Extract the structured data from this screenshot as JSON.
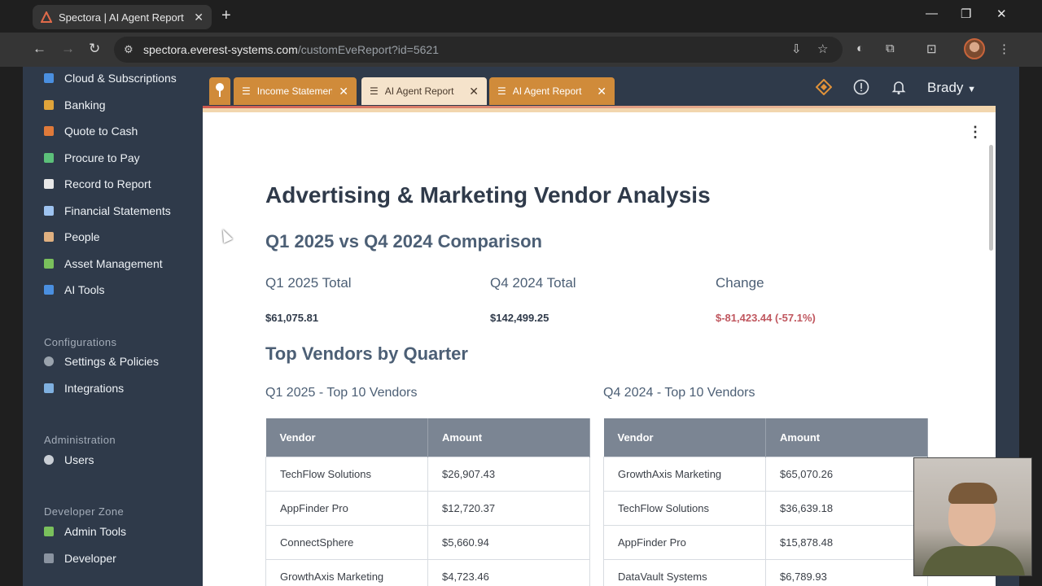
{
  "browser": {
    "tab_title": "Spectora | AI Agent Report",
    "url_host": "spectora.everest-systems.com",
    "url_path": "/customEveReport?id=5621"
  },
  "sidebar": {
    "items": [
      {
        "label": "Cloud & Subscriptions",
        "color": "#4a8fe0"
      },
      {
        "label": "Banking",
        "color": "#e0a43a"
      },
      {
        "label": "Quote to Cash",
        "color": "#e07a3a"
      },
      {
        "label": "Procure to Pay",
        "color": "#5cc07a"
      },
      {
        "label": "Record to Report",
        "color": "#e8e8e8"
      },
      {
        "label": "Financial Statements",
        "color": "#9ec3f0"
      },
      {
        "label": "People",
        "color": "#e0b080"
      },
      {
        "label": "Asset Management",
        "color": "#7ac05c"
      },
      {
        "label": "AI Tools",
        "color": "#4a8fe0"
      }
    ],
    "configurations_label": "Configurations",
    "config_items": [
      {
        "label": "Settings & Policies"
      },
      {
        "label": "Integrations"
      }
    ],
    "administration_label": "Administration",
    "admin_items": [
      {
        "label": "Users"
      }
    ],
    "developer_label": "Developer Zone",
    "developer_items": [
      {
        "label": "Admin Tools"
      },
      {
        "label": "Developer"
      }
    ]
  },
  "app_tabs": [
    {
      "label": "Income Statement",
      "active": false
    },
    {
      "label": "AI Agent Report",
      "active": true
    },
    {
      "label": "AI Agent Report",
      "active": false
    }
  ],
  "header": {
    "user_name": "Brady"
  },
  "report": {
    "title": "Advertising & Marketing Vendor Analysis",
    "subtitle": "Q1 2025 vs Q4 2024 Comparison",
    "stats": [
      {
        "label": "Q1 2025 Total",
        "value": "$61,075.81"
      },
      {
        "label": "Q4 2024 Total",
        "value": "$142,499.25"
      },
      {
        "label": "Change",
        "value": "$-81,423.44 (-57.1%)"
      }
    ],
    "section_title": "Top Vendors by Quarter",
    "q1_caption": "Q1 2025 - Top 10 Vendors",
    "q4_caption": "Q4 2024 - Top 10 Vendors",
    "col_vendor": "Vendor",
    "col_amount": "Amount",
    "q1_rows": [
      [
        "TechFlow Solutions",
        "$26,907.43"
      ],
      [
        "AppFinder Pro",
        "$12,720.37"
      ],
      [
        "ConnectSphere",
        "$5,660.94"
      ],
      [
        "GrowthAxis Marketing",
        "$4,723.46"
      ]
    ],
    "q4_rows": [
      [
        "GrowthAxis Marketing",
        "$65,070.26"
      ],
      [
        "TechFlow Solutions",
        "$36,639.18"
      ],
      [
        "AppFinder Pro",
        "$15,878.48"
      ],
      [
        "DataVault Systems",
        "$6,789.93"
      ]
    ]
  }
}
